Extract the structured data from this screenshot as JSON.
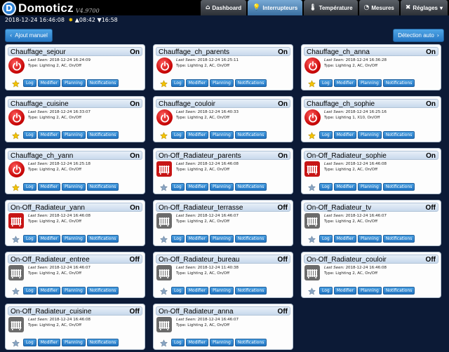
{
  "app": {
    "name": "Domoticz",
    "version": "V4.9700"
  },
  "nav": [
    {
      "label": "Dashboard",
      "icon": "home-icon",
      "glyph": "⌂",
      "active": false
    },
    {
      "label": "Interrupteurs",
      "icon": "bulb-icon",
      "glyph": "💡",
      "active": true
    },
    {
      "label": "Température",
      "icon": "thermometer-icon",
      "glyph": "🌡",
      "active": false
    },
    {
      "label": "Mesures",
      "icon": "gauge-icon",
      "glyph": "◔",
      "active": false
    },
    {
      "label": "Réglages",
      "icon": "wrench-icon",
      "glyph": "✖",
      "active": false,
      "dropdown": true
    }
  ],
  "status": {
    "datetime": "2018-12-24 16:46:08",
    "sunrise": "08:42",
    "sunset": "16:58"
  },
  "buttons": {
    "add": "Ajout manuel",
    "detect": "Détection auto"
  },
  "labels": {
    "last_seen": "Last Seen:",
    "type_prefix": "Type:",
    "actions": [
      "Log",
      "Modifier",
      "Planning",
      "Notifications"
    ]
  },
  "colors": {
    "background": "#0c1a36",
    "accent": "#2677c4",
    "on_red": "#c71515",
    "off_gray": "#6b6b6b"
  },
  "devices": [
    {
      "name": "Chauffage_sejour",
      "state": "On",
      "last_seen": "2018-12-24 16:24:09",
      "type": "Lighting 2, AC, On/Off",
      "icon": "power-icon",
      "favorite": true
    },
    {
      "name": "Chauffage_ch_parents",
      "state": "On",
      "last_seen": "2018-12-24 16:25:11",
      "type": "Lighting 2, AC, On/Off",
      "icon": "power-icon",
      "favorite": true
    },
    {
      "name": "Chauffage_ch_anna",
      "state": "On",
      "last_seen": "2018-12-24 16:36:28",
      "type": "Lighting 2, AC, On/Off",
      "icon": "power-icon",
      "favorite": true
    },
    {
      "name": "Chauffage_cuisine",
      "state": "On",
      "last_seen": "2018-12-24 16:33:07",
      "type": "Lighting 2, AC, On/Off",
      "icon": "power-icon",
      "favorite": true
    },
    {
      "name": "Chauffage_couloir",
      "state": "On",
      "last_seen": "2018-12-24 16:40:33",
      "type": "Lighting 2, AC, On/Off",
      "icon": "power-icon",
      "favorite": true
    },
    {
      "name": "Chauffage_ch_sophie",
      "state": "On",
      "last_seen": "2018-12-24 16:25:16",
      "type": "Lighting 1, X10, On/Off",
      "icon": "power-icon",
      "favorite": true
    },
    {
      "name": "Chauffage_ch_yann",
      "state": "On",
      "last_seen": "2018-12-24 16:25:18",
      "type": "Lighting 2, AC, On/Off",
      "icon": "power-icon",
      "favorite": true
    },
    {
      "name": "On-Off_Radiateur_parents",
      "state": "On",
      "last_seen": "2018-12-24 16:46:08",
      "type": "Lighting 2, AC, On/Off",
      "icon": "radiator-on-icon",
      "favorite": false
    },
    {
      "name": "On-Off_Radiateur_sophie",
      "state": "On",
      "last_seen": "2018-12-24 16:46:08",
      "type": "Lighting 2, AC, On/Off",
      "icon": "radiator-on-icon",
      "favorite": false
    },
    {
      "name": "On-Off_Radiateur_yann",
      "state": "On",
      "last_seen": "2018-12-24 16:46:08",
      "type": "Lighting 2, AC, On/Off",
      "icon": "radiator-on-icon",
      "favorite": false
    },
    {
      "name": "On-Off_Radiateur_terrasse",
      "state": "Off",
      "last_seen": "2018-12-24 16:46:07",
      "type": "Lighting 2, AC, On/Off",
      "icon": "radiator-off-icon",
      "favorite": false
    },
    {
      "name": "On-Off_Radiateur_tv",
      "state": "Off",
      "last_seen": "2018-12-24 16:46:07",
      "type": "Lighting 2, AC, On/Off",
      "icon": "radiator-off-icon",
      "favorite": false
    },
    {
      "name": "On-Off_Radiateur_entree",
      "state": "Off",
      "last_seen": "2018-12-24 16:46:07",
      "type": "Lighting 2, AC, On/Off",
      "icon": "radiator-off-icon",
      "favorite": false
    },
    {
      "name": "On-Off_Radiateur_bureau",
      "state": "Off",
      "last_seen": "2018-12-24 11:40:38",
      "type": "Lighting 2, AC, On/Off",
      "icon": "radiator-off-icon",
      "favorite": false
    },
    {
      "name": "On-Off_Radiateur_couloir",
      "state": "Off",
      "last_seen": "2018-12-24 16:46:08",
      "type": "Lighting 2, AC, On/Off",
      "icon": "radiator-off-icon",
      "favorite": false
    },
    {
      "name": "On-Off_Radiateur_cuisine",
      "state": "Off",
      "last_seen": "2018-12-24 16:46:08",
      "type": "Lighting 2, AC, On/Off",
      "icon": "radiator-off-icon",
      "favorite": false
    },
    {
      "name": "On-Off_Radiateur_anna",
      "state": "Off",
      "last_seen": "2018-12-24 16:46:07",
      "type": "Lighting 2, AC, On/Off",
      "icon": "radiator-off-icon",
      "favorite": false
    }
  ]
}
